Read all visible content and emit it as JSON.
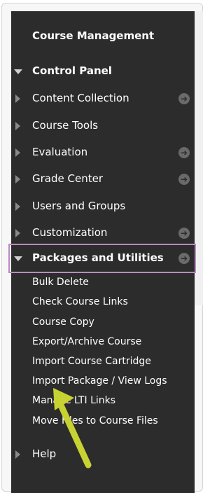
{
  "panel": {
    "title": "Course Management",
    "control_panel": "Control Panel",
    "menu": [
      {
        "label": "Content Collection"
      },
      {
        "label": "Course Tools"
      },
      {
        "label": "Evaluation"
      },
      {
        "label": "Grade Center"
      },
      {
        "label": "Users and Groups"
      },
      {
        "label": "Customization"
      },
      {
        "label": "Packages and Utilities"
      }
    ],
    "submenu": [
      "Bulk Delete",
      "Check Course Links",
      "Course Copy",
      "Export/Archive Course",
      "Import Course Cartridge",
      "Import Package / View Logs",
      "Manage LTI Links",
      "Move Files to Course Files"
    ],
    "help": "Help"
  },
  "colors": {
    "panel_bg": "#2c2c2c",
    "highlight_border": "#b98bc2",
    "pointer_arrow": "#c7d233"
  }
}
